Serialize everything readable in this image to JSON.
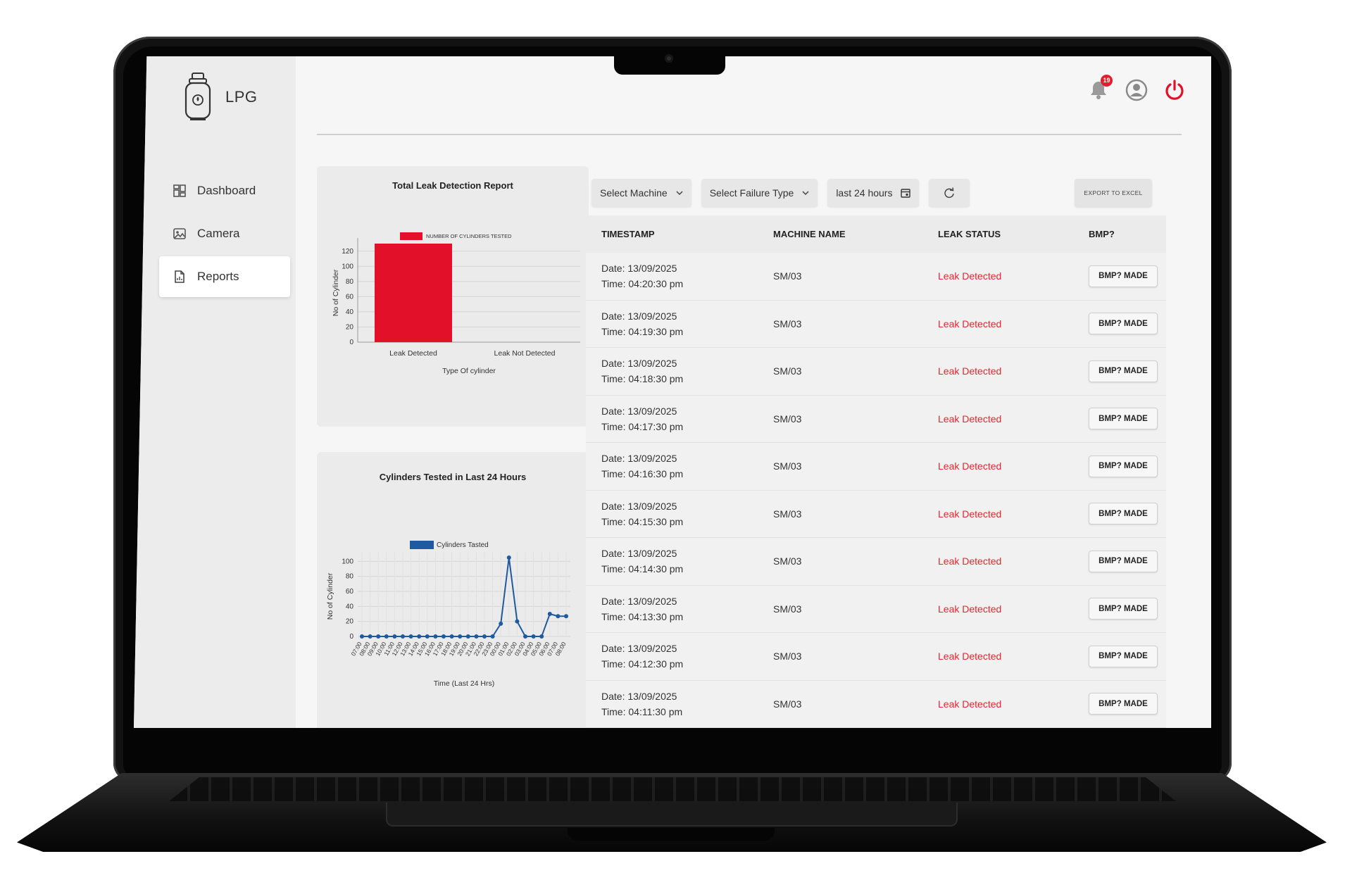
{
  "app": {
    "brand": "LPG",
    "notifications_count": "19"
  },
  "sidebar": {
    "items": [
      {
        "label": "Dashboard",
        "icon": "dashboard-icon"
      },
      {
        "label": "Camera",
        "icon": "camera-icon"
      },
      {
        "label": "Reports",
        "icon": "report-icon",
        "active": true
      }
    ]
  },
  "filters": {
    "machine": "Select Machine",
    "failure_type": "Select Failure Type",
    "date_range": "last 24 hours",
    "export_label": "EXPORT TO EXCEL"
  },
  "table": {
    "headers": [
      "TIMESTAMP",
      "MACHINE NAME",
      "LEAK STATUS",
      "BMP?"
    ],
    "date_prefix": "Date:",
    "time_prefix": "Time:",
    "rows": [
      {
        "date": "13/09/2025",
        "time": "04:20:30 pm",
        "machine": "SM/03",
        "status": "Leak Detected",
        "bmp": "BMP? MADE"
      },
      {
        "date": "13/09/2025",
        "time": "04:19:30 pm",
        "machine": "SM/03",
        "status": "Leak Detected",
        "bmp": "BMP? MADE"
      },
      {
        "date": "13/09/2025",
        "time": "04:18:30 pm",
        "machine": "SM/03",
        "status": "Leak Detected",
        "bmp": "BMP? MADE"
      },
      {
        "date": "13/09/2025",
        "time": "04:17:30 pm",
        "machine": "SM/03",
        "status": "Leak Detected",
        "bmp": "BMP? MADE"
      },
      {
        "date": "13/09/2025",
        "time": "04:16:30 pm",
        "machine": "SM/03",
        "status": "Leak Detected",
        "bmp": "BMP? MADE"
      },
      {
        "date": "13/09/2025",
        "time": "04:15:30 pm",
        "machine": "SM/03",
        "status": "Leak Detected",
        "bmp": "BMP? MADE"
      },
      {
        "date": "13/09/2025",
        "time": "04:14:30 pm",
        "machine": "SM/03",
        "status": "Leak Detected",
        "bmp": "BMP? MADE"
      },
      {
        "date": "13/09/2025",
        "time": "04:13:30 pm",
        "machine": "SM/03",
        "status": "Leak Detected",
        "bmp": "BMP? MADE"
      },
      {
        "date": "13/09/2025",
        "time": "04:12:30 pm",
        "machine": "SM/03",
        "status": "Leak Detected",
        "bmp": "BMP? MADE"
      },
      {
        "date": "13/09/2025",
        "time": "04:11:30 pm",
        "machine": "SM/03",
        "status": "Leak Detected",
        "bmp": "BMP? MADE"
      }
    ]
  },
  "colors": {
    "accent_red": "#e3102a",
    "status_red": "#e3262f",
    "series_blue": "#1f5aa0"
  },
  "chart_data": [
    {
      "type": "bar",
      "title": "Total Leak Detection Report",
      "xlabel": "Type Of cylinder",
      "ylabel": "No of Cylinder",
      "categories": [
        "Leak Detected",
        "Leak Not Detected"
      ],
      "series": [
        {
          "name": "NUMBER OF CYLINDERS TESTED",
          "values": [
            130,
            0
          ]
        }
      ],
      "ylim": [
        0,
        130
      ],
      "yticks": [
        0,
        20,
        40,
        60,
        80,
        100,
        120
      ],
      "grid": true,
      "legend": "top"
    },
    {
      "type": "line",
      "title": "Cylinders Tested in Last 24 Hours",
      "xlabel": "Time (Last 24 Hrs)",
      "ylabel": "No of Cylinder",
      "categories": [
        "07:00",
        "08:00",
        "09:00",
        "10:00",
        "11:00",
        "12:00",
        "13:00",
        "14:00",
        "15:00",
        "16:00",
        "17:00",
        "18:00",
        "19:00",
        "20:00",
        "21:00",
        "22:00",
        "23:00",
        "00:00",
        "01:00",
        "02:00",
        "03:00",
        "04:00",
        "05:00",
        "06:00",
        "07:00",
        "08:00"
      ],
      "series": [
        {
          "name": "Cylinders Tasted",
          "values": [
            0,
            0,
            0,
            0,
            0,
            0,
            0,
            0,
            0,
            0,
            0,
            0,
            0,
            0,
            0,
            0,
            0,
            17,
            105,
            20,
            0,
            0,
            0,
            30,
            27,
            27
          ]
        }
      ],
      "ylim": [
        0,
        105
      ],
      "yticks": [
        0,
        20,
        40,
        60,
        80,
        100
      ],
      "grid": true,
      "legend": "top"
    }
  ]
}
